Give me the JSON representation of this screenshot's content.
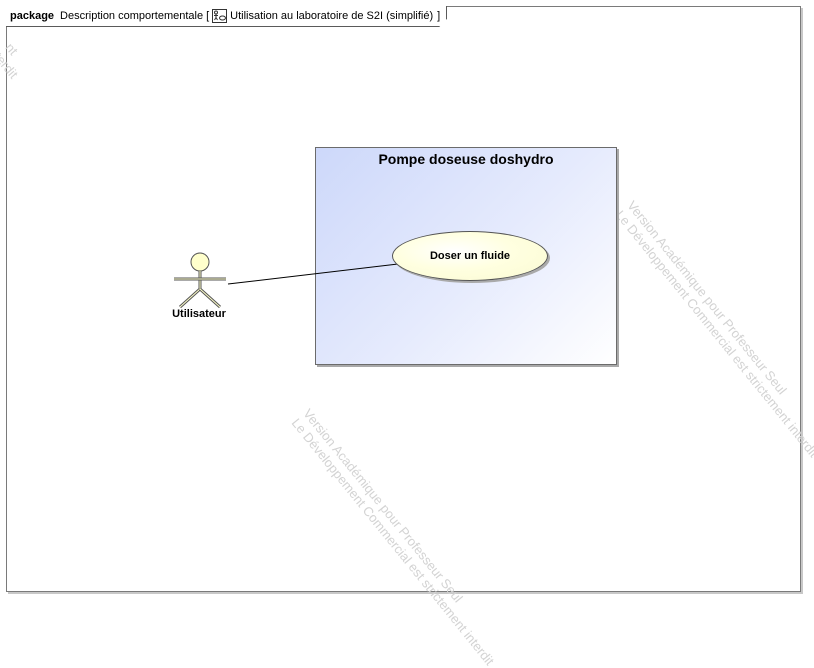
{
  "frame": {
    "keyword": "package",
    "name": "Description comportementale",
    "open_bracket": "[",
    "diagram_name": "Utilisation au laboratoire de S2I (simplifié)",
    "close_bracket": "]"
  },
  "subject": {
    "title": "Pompe doseuse doshydro"
  },
  "use_case": {
    "label": "Doser un fluide"
  },
  "actor": {
    "label": "Utilisateur"
  },
  "watermarks": {
    "line1": "Version Académique pour Professeur Seul",
    "line2": "Le Développement Commercial est strictement interdit",
    "corner1": "nt",
    "corner2": "terdit"
  },
  "colors": {
    "subject_fill": "#cdd8fa",
    "usecase_fill": "#ffffe0",
    "actor_head": "#ffffcc",
    "watermark": "#d3d3d3"
  }
}
